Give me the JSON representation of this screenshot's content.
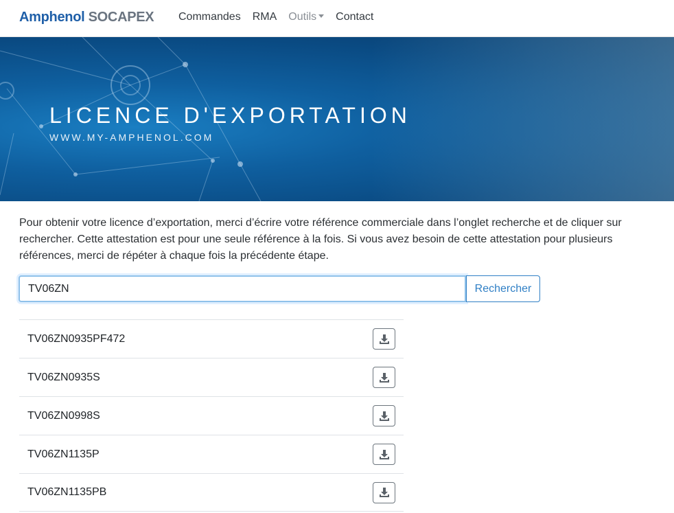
{
  "brand": {
    "part1": "Amphenol",
    "part2": "SOCAPEX"
  },
  "nav": [
    {
      "label": "Commandes"
    },
    {
      "label": "RMA"
    },
    {
      "label": "Outils"
    },
    {
      "label": "Contact"
    }
  ],
  "hero": {
    "title": "LICENCE D'EXPORTATION",
    "subtitle": "WWW.MY-AMPHENOL.COM"
  },
  "intro": "Pour obtenir votre licence d’exportation, merci d’écrire votre référence commerciale dans l’onglet recherche et de cliquer sur rechercher. Cette attestation est pour une seule référence à la fois. Si vous avez besoin de cette attestation pour plusieurs références, merci de répéter à chaque fois la précédente étape.",
  "search": {
    "value": "TV06ZN",
    "button_label": "Rechercher"
  },
  "results": [
    {
      "reference": "TV06ZN0935PF472",
      "icon": "download-icon"
    },
    {
      "reference": "TV06ZN0935S",
      "icon": "download-icon"
    },
    {
      "reference": "TV06ZN0998S",
      "icon": "download-icon"
    },
    {
      "reference": "TV06ZN1135P",
      "icon": "download-icon"
    },
    {
      "reference": "TV06ZN1135PB",
      "icon": "download-icon"
    }
  ],
  "colors": {
    "brand_blue": "#1f5fa8",
    "brand_gray": "#6a7480",
    "accent": "#2f7fc5"
  }
}
